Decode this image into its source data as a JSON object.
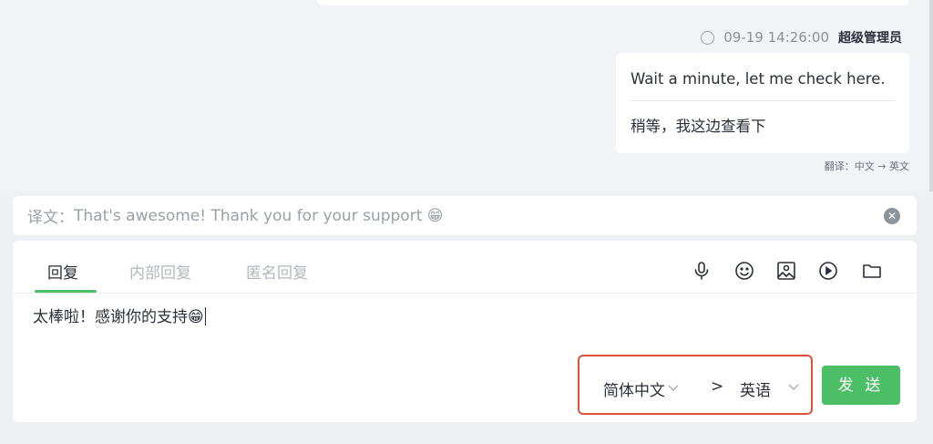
{
  "conversation": {
    "message": {
      "status_icon": "circle-outline-icon",
      "timestamp": "09-19 14:26:00",
      "sender": "超级管理员",
      "original_text": "Wait a minute, let me check here.",
      "translated_text": "稍等，我这边查看下",
      "translation_note": "翻译：中文 → 英文"
    }
  },
  "translation_preview": {
    "label": "译文：",
    "text": "That's awesome! Thank you for your support 😁",
    "clear_icon": "close-circle-icon"
  },
  "reply_panel": {
    "tabs": [
      {
        "label": "回复",
        "active": true
      },
      {
        "label": "内部回复",
        "active": false
      },
      {
        "label": "匿名回复",
        "active": false
      }
    ],
    "toolbar": [
      "microphone-icon",
      "emoji-icon",
      "image-icon",
      "video-icon",
      "folder-icon"
    ],
    "input_text": "太棒啦！感谢你的支持😁",
    "source_language": "简体中文",
    "arrow": ">",
    "target_language": "英语",
    "send_label": "发 送"
  },
  "colors": {
    "accent": "#4cbf66",
    "highlight_border": "#d9553a"
  }
}
